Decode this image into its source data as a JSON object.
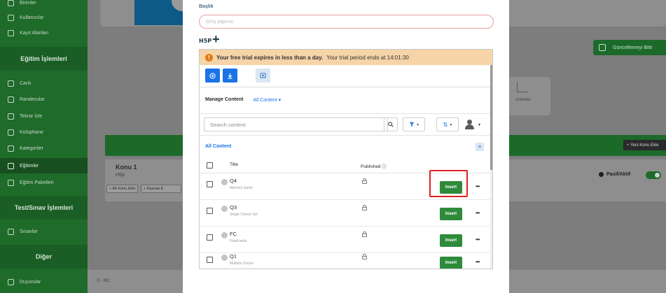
{
  "sidebar": {
    "top_items": [
      {
        "label": "Birimler",
        "icon": "building-icon"
      },
      {
        "label": "Kullanıcılar",
        "icon": "users-icon"
      },
      {
        "label": "Kayıt Alanları",
        "icon": "form-icon"
      }
    ],
    "section_egitim": "Eğitim İşlemleri",
    "egitim_items": [
      {
        "label": "Canlı",
        "icon": "video-icon"
      },
      {
        "label": "Randevular",
        "icon": "calendar-icon"
      },
      {
        "label": "Tekrar İzle",
        "icon": "replay-icon"
      },
      {
        "label": "Kütüphane",
        "icon": "library-icon"
      },
      {
        "label": "Kategoriler",
        "icon": "category-icon"
      },
      {
        "label": "Eğitimler",
        "icon": "book-icon"
      },
      {
        "label": "Eğitim Paketleri",
        "icon": "package-icon"
      }
    ],
    "section_test": "Test/Sınav İşlemleri",
    "test_items": [
      {
        "label": "Sınavlar",
        "icon": "exam-icon"
      }
    ],
    "section_diger": "Diğer",
    "diger_items": [
      {
        "label": "Duyurular",
        "icon": "megaphone-icon"
      }
    ]
  },
  "background": {
    "update_button": "Güncellemeyi Bitir",
    "stat_label": "Anketler",
    "new_topic_button": "+ Yeni Konu Ekle",
    "topic_title": "Konu 1",
    "topic_sub": "H5p",
    "add_subtopic": "+ Alt Konu Ekle",
    "add_source": "+ Kaynak E",
    "status_label": "Pasif/Aktif",
    "footer": "© - RC"
  },
  "modal": {
    "title_label": "Başlık",
    "title_placeholder": "Giriş yapınız.",
    "h5p_logo_text": "H5P"
  },
  "h5p": {
    "trial_bold": "Your free trial expires in less than a day.",
    "trial_rest": "Your trial period ends at 14:01:30",
    "toolbar": {
      "add_icon": "plus-icon",
      "download_icon": "download-icon",
      "media_icon": "media-icon"
    },
    "manage_content": "Manage Content",
    "all_content_dropdown": "All Content ▾",
    "search_placeholder": "Search content",
    "all_content_heading": "All Content",
    "columns": {
      "title": "Title",
      "published": "Published ⓘ"
    },
    "insert_label": "Insert",
    "more_label": "•••",
    "rows": [
      {
        "name": "Q4",
        "kind": "Memory Game"
      },
      {
        "name": "Q3",
        "kind": "Single Choice Set"
      },
      {
        "name": "FC",
        "kind": "Flashcards"
      },
      {
        "name": "Q1",
        "kind": "Multiple Choice"
      }
    ]
  },
  "colors": {
    "sidebar_green": "#1e6b2a",
    "insert_green": "#2e8b3a",
    "primary_blue": "#1a73e8",
    "trial_banner": "#f6d4a8",
    "highlight_red": "#e02020"
  }
}
